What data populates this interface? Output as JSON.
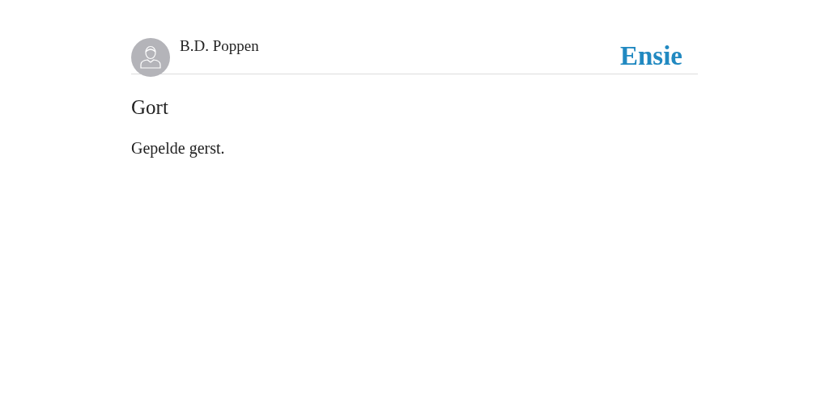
{
  "header": {
    "author": "B.D. Poppen",
    "logo": "Ensie"
  },
  "entry": {
    "title": "Gort",
    "definition": "Gepelde gerst."
  }
}
